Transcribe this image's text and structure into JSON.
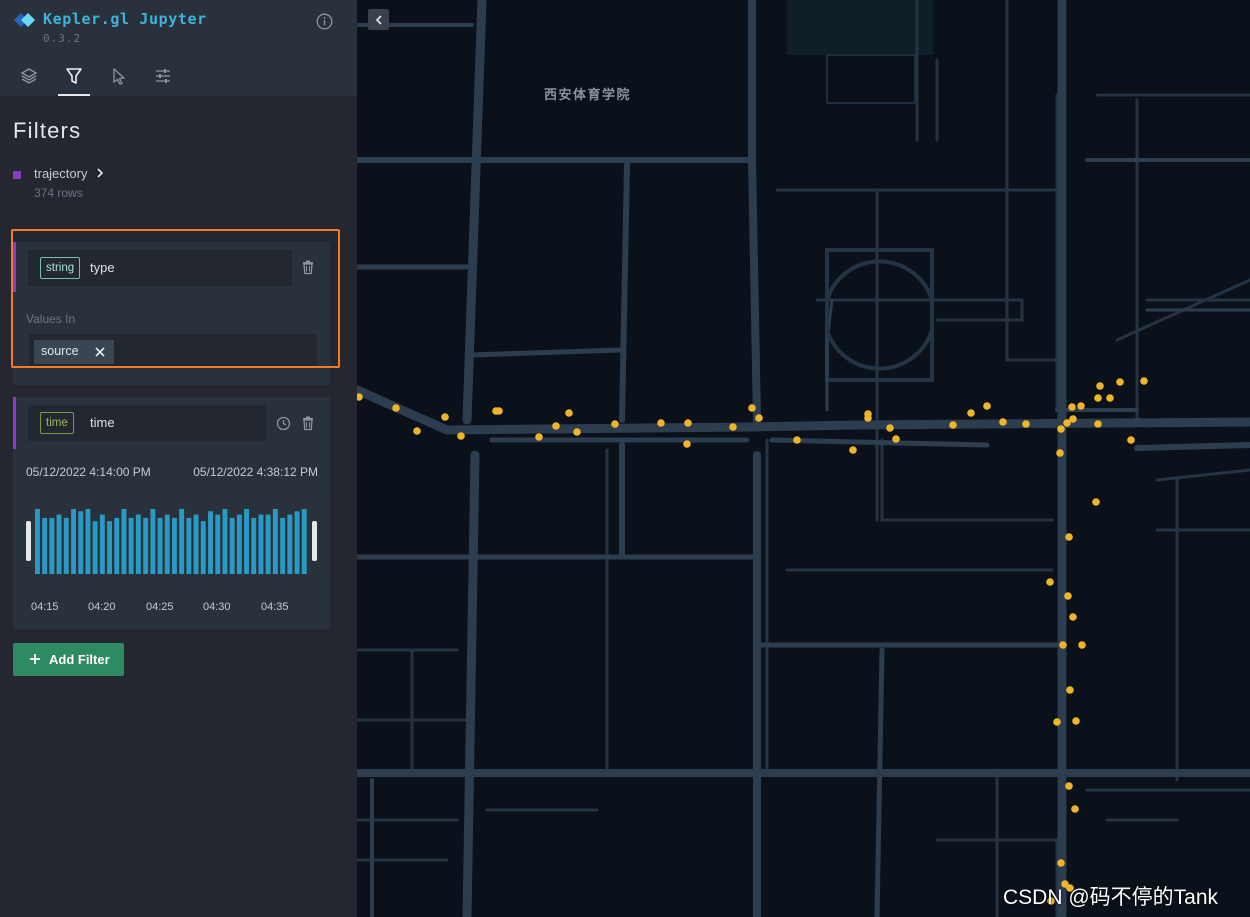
{
  "app": {
    "title": "Kepler.gl Jupyter",
    "version": "0.3.2"
  },
  "tabs": [
    {
      "name": "layers",
      "icon": "layers-icon"
    },
    {
      "name": "filters",
      "icon": "filter-icon",
      "active": true
    },
    {
      "name": "interactions",
      "icon": "cursor-icon"
    },
    {
      "name": "base map",
      "icon": "settings-sliders-icon"
    }
  ],
  "panel": {
    "title": "Filters"
  },
  "dataset": {
    "name": "trajectory",
    "rows": "374 rows",
    "color": "#8a3cc9"
  },
  "filters": [
    {
      "type_pill": "string",
      "field": "type",
      "values_label": "Values In",
      "values": [
        "source"
      ]
    },
    {
      "type_pill": "time",
      "field": "time",
      "range_start": "05/12/2022 4:14:00 PM",
      "range_end": "05/12/2022 4:38:12 PM",
      "histogram": [
        20,
        17,
        17,
        18,
        17,
        20,
        19,
        20,
        16,
        18,
        16,
        17,
        20,
        17,
        18,
        17,
        20,
        17,
        18,
        17,
        20,
        17,
        18,
        16,
        19,
        18,
        20,
        17,
        18,
        20,
        17,
        18,
        18,
        20,
        17,
        18,
        19,
        20
      ],
      "ticks": [
        "04:15",
        "04:20",
        "04:25",
        "04:30",
        "04:35"
      ]
    }
  ],
  "add_filter": {
    "label": "Add Filter"
  },
  "map": {
    "poi_label": "西安体育学院",
    "point_color": "#f0b429"
  },
  "watermark": "CSDN @码不停的Tank"
}
